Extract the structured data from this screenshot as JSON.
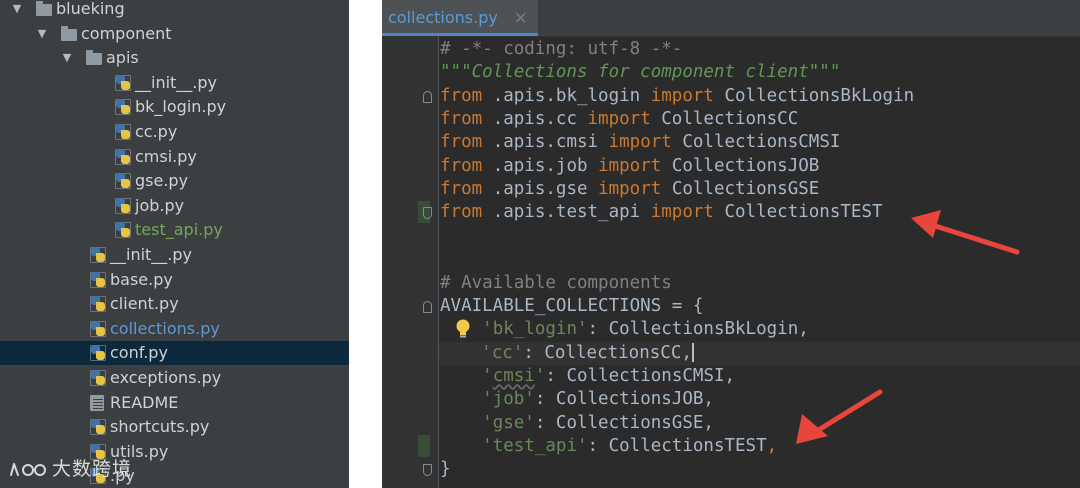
{
  "tree": {
    "items": [
      {
        "name": "blueking",
        "type": "folder",
        "indent": 0,
        "arrow": "▼",
        "color": "normal"
      },
      {
        "name": "component",
        "type": "folder",
        "indent": 1,
        "arrow": "▼",
        "color": "normal"
      },
      {
        "name": "apis",
        "type": "folder",
        "indent": 2,
        "arrow": "▼",
        "color": "normal"
      },
      {
        "name": "__init__.py",
        "type": "py",
        "indent": 3,
        "color": "normal"
      },
      {
        "name": "bk_login.py",
        "type": "py",
        "indent": 3,
        "color": "normal"
      },
      {
        "name": "cc.py",
        "type": "py",
        "indent": 3,
        "color": "normal"
      },
      {
        "name": "cmsi.py",
        "type": "py",
        "indent": 3,
        "color": "normal"
      },
      {
        "name": "gse.py",
        "type": "py",
        "indent": 3,
        "color": "normal"
      },
      {
        "name": "job.py",
        "type": "py",
        "indent": 3,
        "color": "normal"
      },
      {
        "name": "test_api.py",
        "type": "py",
        "indent": 3,
        "color": "green"
      },
      {
        "name": "__init__.py",
        "type": "py",
        "indent": 2,
        "color": "normal"
      },
      {
        "name": "base.py",
        "type": "py",
        "indent": 2,
        "color": "normal"
      },
      {
        "name": "client.py",
        "type": "py",
        "indent": 2,
        "color": "normal"
      },
      {
        "name": "collections.py",
        "type": "py",
        "indent": 2,
        "color": "blue"
      },
      {
        "name": "conf.py",
        "type": "py",
        "indent": 2,
        "color": "normal",
        "selected": true
      },
      {
        "name": "exceptions.py",
        "type": "py",
        "indent": 2,
        "color": "normal"
      },
      {
        "name": "README",
        "type": "doc",
        "indent": 2,
        "color": "normal"
      },
      {
        "name": "shortcuts.py",
        "type": "py",
        "indent": 2,
        "color": "normal"
      },
      {
        "name": "utils.py",
        "type": "py",
        "indent": 2,
        "color": "normal"
      },
      {
        "name": ".py",
        "type": "py",
        "indent": 2,
        "color": "normal"
      }
    ]
  },
  "watermark": {
    "text": "大数跨境"
  },
  "editor": {
    "tab": {
      "label": "collections.py",
      "close": "×"
    },
    "lines": [
      [
        {
          "t": "# -*- coding: utf-8 -*-",
          "c": "cm"
        }
      ],
      [
        {
          "t": "\"\"\"Collections for component client\"\"\"",
          "c": "doc"
        }
      ],
      [
        {
          "t": "from",
          "c": "kw"
        },
        {
          "t": " .apis.bk_login ",
          "c": ""
        },
        {
          "t": "import",
          "c": "kw"
        },
        {
          "t": " CollectionsBkLogin",
          "c": ""
        }
      ],
      [
        {
          "t": "from",
          "c": "kw"
        },
        {
          "t": " .apis.cc ",
          "c": ""
        },
        {
          "t": "import",
          "c": "kw"
        },
        {
          "t": " CollectionsCC",
          "c": ""
        }
      ],
      [
        {
          "t": "from",
          "c": "kw"
        },
        {
          "t": " .apis.cmsi ",
          "c": ""
        },
        {
          "t": "import",
          "c": "kw"
        },
        {
          "t": " CollectionsCMSI",
          "c": ""
        }
      ],
      [
        {
          "t": "from",
          "c": "kw"
        },
        {
          "t": " .apis.job ",
          "c": ""
        },
        {
          "t": "import",
          "c": "kw"
        },
        {
          "t": " CollectionsJOB",
          "c": ""
        }
      ],
      [
        {
          "t": "from",
          "c": "kw"
        },
        {
          "t": " .apis.gse ",
          "c": ""
        },
        {
          "t": "import",
          "c": "kw"
        },
        {
          "t": " CollectionsGSE",
          "c": ""
        }
      ],
      [
        {
          "t": "from",
          "c": "kw"
        },
        {
          "t": " .apis.test_api ",
          "c": ""
        },
        {
          "t": "import",
          "c": "kw"
        },
        {
          "t": " CollectionsTEST",
          "c": ""
        }
      ],
      [],
      [],
      [
        {
          "t": "# Available components",
          "c": "cm"
        }
      ],
      [
        {
          "t": "AVAILABLE_COLLECTIONS = {",
          "c": ""
        }
      ],
      [
        {
          "t": "    ",
          "c": ""
        },
        {
          "t": "'bk_login'",
          "c": "str"
        },
        {
          "t": ": CollectionsBkLogin,",
          "c": ""
        }
      ],
      [
        {
          "t": "    ",
          "c": ""
        },
        {
          "t": "'cc'",
          "c": "str"
        },
        {
          "t": ": CollectionsCC,",
          "c": ""
        },
        {
          "t": "",
          "c": "caret"
        }
      ],
      [
        {
          "t": "    ",
          "c": ""
        },
        {
          "t": "'",
          "c": "str"
        },
        {
          "t": "cmsi",
          "c": "str wave"
        },
        {
          "t": "'",
          "c": "str"
        },
        {
          "t": ": CollectionsCMSI,",
          "c": ""
        }
      ],
      [
        {
          "t": "    ",
          "c": ""
        },
        {
          "t": "'job'",
          "c": "str"
        },
        {
          "t": ": CollectionsJOB,",
          "c": ""
        }
      ],
      [
        {
          "t": "    ",
          "c": ""
        },
        {
          "t": "'gse'",
          "c": "str"
        },
        {
          "t": ": CollectionsGSE,",
          "c": ""
        }
      ],
      [
        {
          "t": "    ",
          "c": ""
        },
        {
          "t": "'test_api'",
          "c": "str"
        },
        {
          "t": ": CollectionsTEST",
          "c": ""
        },
        {
          "t": ",",
          "c": "kw"
        }
      ],
      [
        {
          "t": "}",
          "c": ""
        }
      ]
    ],
    "highlighted_line": 13,
    "changed_lines": [
      7,
      17
    ]
  },
  "colors": {
    "tree_bg": "#3c3f41",
    "editor_bg": "#2b2b2b",
    "arrow": "#e8453c",
    "keyword": "#cc7832",
    "string": "#6a8759"
  }
}
